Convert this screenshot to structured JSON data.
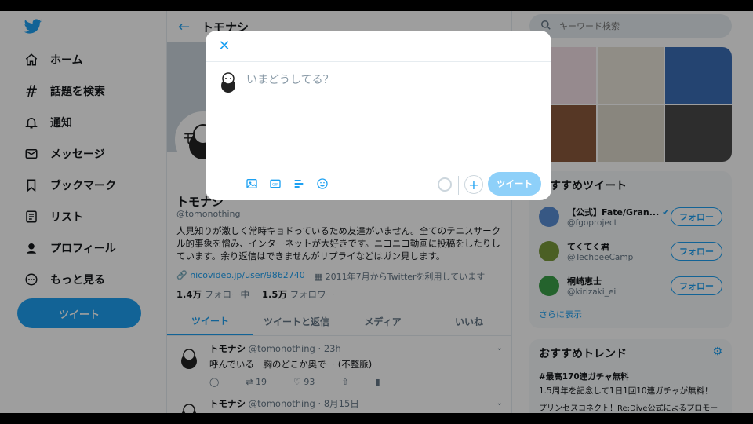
{
  "nav": {
    "items": [
      {
        "label": "ホーム",
        "icon": "home-icon"
      },
      {
        "label": "話題を検索",
        "icon": "hashtag-icon"
      },
      {
        "label": "通知",
        "icon": "bell-icon"
      },
      {
        "label": "メッセージ",
        "icon": "mail-icon"
      },
      {
        "label": "ブックマーク",
        "icon": "bookmark-icon"
      },
      {
        "label": "リスト",
        "icon": "list-icon"
      },
      {
        "label": "プロフィール",
        "icon": "profile-icon"
      },
      {
        "label": "もっと見る",
        "icon": "more-icon"
      }
    ],
    "tweet_button": "ツイート"
  },
  "main": {
    "header_name": "トモナシ",
    "profile": {
      "name": "トモナシ",
      "handle": "@tomonothing",
      "bio": "人見知りが激しく常時キョドっているため友達がいません。全てのテニスサークル的事象を憎み、インターネットが大好きです。ニコニコ動画に投稿をしたりしています。余り返信はできませんがリプライなどはガン見します。",
      "link": "nicovideo.jp/user/9862740",
      "joined": "2011年7月からTwitterを利用しています",
      "following_count": "1.4万",
      "following_label": "フォロー中",
      "followers_count": "1.5万",
      "followers_label": "フォロワー"
    },
    "tabs": [
      "ツイート",
      "ツイートと返信",
      "メディア",
      "いいね"
    ],
    "tweets": [
      {
        "name": "トモナシ",
        "handle": "@tomonothing",
        "time": "· 23h",
        "text": "呼んでいる一胸のどこか奥でー (不整脈)",
        "replies": "",
        "retweets": "19",
        "likes": "93"
      },
      {
        "name": "トモナシ",
        "handle": "@tomonothing",
        "time": "· 8月15日",
        "text": "",
        "replies": "",
        "retweets": "",
        "likes": ""
      }
    ]
  },
  "right": {
    "search_placeholder": "キーワード検索",
    "recommend_title": "おすすめツイート",
    "recommend": [
      {
        "name": "【公式】Fate/Gran...",
        "handle": "@fgoproject",
        "verified": true,
        "button": "フォロー"
      },
      {
        "name": "てくてく君",
        "handle": "@TechbeeCamp",
        "verified": false,
        "button": "フォロー"
      },
      {
        "name": "桐崎恵士",
        "handle": "@kirizaki_ei",
        "verified": false,
        "button": "フォロー"
      }
    ],
    "show_more": "さらに表示",
    "trends_title": "おすすめトレンド",
    "trend": {
      "title": "#最高170連ガチャ無料",
      "desc": "1.5周年を記念して1日1回10連ガチャが無料！",
      "promo": "プリンセスコネクト！Re:Dive公式によるプロモー"
    }
  },
  "modal": {
    "placeholder": "いまどうしてる？",
    "submit": "ツイート",
    "tools": [
      "image-icon",
      "gif-icon",
      "poll-icon",
      "emoji-icon"
    ]
  },
  "colors": {
    "accent": "#1da1f2",
    "disabled_accent": "#8ed0f9"
  }
}
